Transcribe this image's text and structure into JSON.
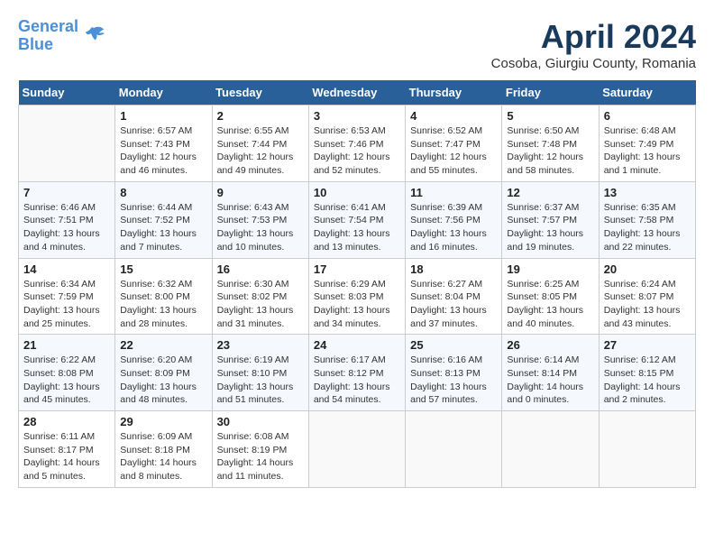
{
  "header": {
    "logo_line1": "General",
    "logo_line2": "Blue",
    "month_title": "April 2024",
    "location": "Cosoba, Giurgiu County, Romania"
  },
  "weekdays": [
    "Sunday",
    "Monday",
    "Tuesday",
    "Wednesday",
    "Thursday",
    "Friday",
    "Saturday"
  ],
  "weeks": [
    [
      {
        "day": "",
        "sunrise": "",
        "sunset": "",
        "daylight": "",
        "empty": true
      },
      {
        "day": "1",
        "sunrise": "6:57 AM",
        "sunset": "7:43 PM",
        "daylight": "12 hours and 46 minutes."
      },
      {
        "day": "2",
        "sunrise": "6:55 AM",
        "sunset": "7:44 PM",
        "daylight": "12 hours and 49 minutes."
      },
      {
        "day": "3",
        "sunrise": "6:53 AM",
        "sunset": "7:46 PM",
        "daylight": "12 hours and 52 minutes."
      },
      {
        "day": "4",
        "sunrise": "6:52 AM",
        "sunset": "7:47 PM",
        "daylight": "12 hours and 55 minutes."
      },
      {
        "day": "5",
        "sunrise": "6:50 AM",
        "sunset": "7:48 PM",
        "daylight": "12 hours and 58 minutes."
      },
      {
        "day": "6",
        "sunrise": "6:48 AM",
        "sunset": "7:49 PM",
        "daylight": "13 hours and 1 minute."
      }
    ],
    [
      {
        "day": "7",
        "sunrise": "6:46 AM",
        "sunset": "7:51 PM",
        "daylight": "13 hours and 4 minutes."
      },
      {
        "day": "8",
        "sunrise": "6:44 AM",
        "sunset": "7:52 PM",
        "daylight": "13 hours and 7 minutes."
      },
      {
        "day": "9",
        "sunrise": "6:43 AM",
        "sunset": "7:53 PM",
        "daylight": "13 hours and 10 minutes."
      },
      {
        "day": "10",
        "sunrise": "6:41 AM",
        "sunset": "7:54 PM",
        "daylight": "13 hours and 13 minutes."
      },
      {
        "day": "11",
        "sunrise": "6:39 AM",
        "sunset": "7:56 PM",
        "daylight": "13 hours and 16 minutes."
      },
      {
        "day": "12",
        "sunrise": "6:37 AM",
        "sunset": "7:57 PM",
        "daylight": "13 hours and 19 minutes."
      },
      {
        "day": "13",
        "sunrise": "6:35 AM",
        "sunset": "7:58 PM",
        "daylight": "13 hours and 22 minutes."
      }
    ],
    [
      {
        "day": "14",
        "sunrise": "6:34 AM",
        "sunset": "7:59 PM",
        "daylight": "13 hours and 25 minutes."
      },
      {
        "day": "15",
        "sunrise": "6:32 AM",
        "sunset": "8:00 PM",
        "daylight": "13 hours and 28 minutes."
      },
      {
        "day": "16",
        "sunrise": "6:30 AM",
        "sunset": "8:02 PM",
        "daylight": "13 hours and 31 minutes."
      },
      {
        "day": "17",
        "sunrise": "6:29 AM",
        "sunset": "8:03 PM",
        "daylight": "13 hours and 34 minutes."
      },
      {
        "day": "18",
        "sunrise": "6:27 AM",
        "sunset": "8:04 PM",
        "daylight": "13 hours and 37 minutes."
      },
      {
        "day": "19",
        "sunrise": "6:25 AM",
        "sunset": "8:05 PM",
        "daylight": "13 hours and 40 minutes."
      },
      {
        "day": "20",
        "sunrise": "6:24 AM",
        "sunset": "8:07 PM",
        "daylight": "13 hours and 43 minutes."
      }
    ],
    [
      {
        "day": "21",
        "sunrise": "6:22 AM",
        "sunset": "8:08 PM",
        "daylight": "13 hours and 45 minutes."
      },
      {
        "day": "22",
        "sunrise": "6:20 AM",
        "sunset": "8:09 PM",
        "daylight": "13 hours and 48 minutes."
      },
      {
        "day": "23",
        "sunrise": "6:19 AM",
        "sunset": "8:10 PM",
        "daylight": "13 hours and 51 minutes."
      },
      {
        "day": "24",
        "sunrise": "6:17 AM",
        "sunset": "8:12 PM",
        "daylight": "13 hours and 54 minutes."
      },
      {
        "day": "25",
        "sunrise": "6:16 AM",
        "sunset": "8:13 PM",
        "daylight": "13 hours and 57 minutes."
      },
      {
        "day": "26",
        "sunrise": "6:14 AM",
        "sunset": "8:14 PM",
        "daylight": "14 hours and 0 minutes."
      },
      {
        "day": "27",
        "sunrise": "6:12 AM",
        "sunset": "8:15 PM",
        "daylight": "14 hours and 2 minutes."
      }
    ],
    [
      {
        "day": "28",
        "sunrise": "6:11 AM",
        "sunset": "8:17 PM",
        "daylight": "14 hours and 5 minutes."
      },
      {
        "day": "29",
        "sunrise": "6:09 AM",
        "sunset": "8:18 PM",
        "daylight": "14 hours and 8 minutes."
      },
      {
        "day": "30",
        "sunrise": "6:08 AM",
        "sunset": "8:19 PM",
        "daylight": "14 hours and 11 minutes."
      },
      {
        "day": "",
        "sunrise": "",
        "sunset": "",
        "daylight": "",
        "empty": true
      },
      {
        "day": "",
        "sunrise": "",
        "sunset": "",
        "daylight": "",
        "empty": true
      },
      {
        "day": "",
        "sunrise": "",
        "sunset": "",
        "daylight": "",
        "empty": true
      },
      {
        "day": "",
        "sunrise": "",
        "sunset": "",
        "daylight": "",
        "empty": true
      }
    ]
  ]
}
